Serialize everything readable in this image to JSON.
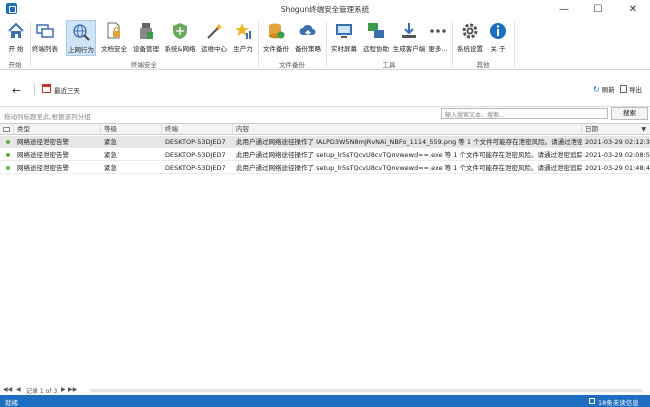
{
  "window": {
    "title": "Shogun终端安全管理系统"
  },
  "ribbon": {
    "buttons": [
      {
        "label": "开 始"
      },
      {
        "label": "终端列表"
      },
      {
        "label": "上网行为"
      },
      {
        "label": "文档安全"
      },
      {
        "label": "设备管理"
      },
      {
        "label": "系统&网络"
      },
      {
        "label": "运维中心"
      },
      {
        "label": "生产力"
      },
      {
        "label": "文件备份"
      },
      {
        "label": "备份策略"
      },
      {
        "label": "实时屏幕"
      },
      {
        "label": "远程协助"
      },
      {
        "label": "生成客户端"
      },
      {
        "label": "更多..."
      },
      {
        "label": "系统设置"
      },
      {
        "label": "关 于"
      }
    ],
    "groups": [
      {
        "label": "开始"
      },
      {
        "label": "终端安全"
      },
      {
        "label": "文件备份"
      },
      {
        "label": "工具"
      },
      {
        "label": "其他"
      }
    ]
  },
  "nav": {
    "date_range": "最近三天",
    "refresh": "刷新",
    "export": "导出"
  },
  "toolbar": {
    "group_hint": "拖动列标题至此,根据该列分组",
    "search_placeholder": "输入搜索文本、搜索...",
    "search_button": "搜索"
  },
  "table": {
    "columns": [
      "类型",
      "等级",
      "终端",
      "内容",
      "日期"
    ],
    "rows": [
      {
        "type": "网络途径泄密告警",
        "level": "紧急",
        "terminal": "DESKTOP-53DJED7",
        "content": "此用户通过网络途径操作了 lALPD3W5N8mJRvNAi_NBFo_1114_559.png 等 1 个文件可能存在泄密风险。请通过泄密追踪...",
        "date": "2021-03-29 02:12:36"
      },
      {
        "type": "网络途径泄密告警",
        "level": "紧急",
        "terminal": "DESKTOP-53DJED7",
        "content": "此用户通过网络途径操作了 setup_lr5sTQcvU8cvTQnvwewd==.exe 等 1 个文件可能存在泄密风险。请通过泄密追踪记录...",
        "date": "2021-03-29 02:08:59"
      },
      {
        "type": "网络途径泄密告警",
        "level": "紧急",
        "terminal": "DESKTOP-53DJED7",
        "content": "此用户通过网络途径操作了 setup_lr5sTQcvU8cvTQnvwewd==.exe 等 1 个文件可能存在泄密风险。请通过泄密追踪记录...",
        "date": "2021-03-29 01:48:47"
      }
    ]
  },
  "pager": {
    "record_text": "记录 1 of 3"
  },
  "status": {
    "left": "就绪",
    "right": "18条未读信息"
  },
  "colors": {
    "accent": "#1b6ec2",
    "active_tab": "#cfe4f7",
    "status_dot": "#5fb53d"
  }
}
